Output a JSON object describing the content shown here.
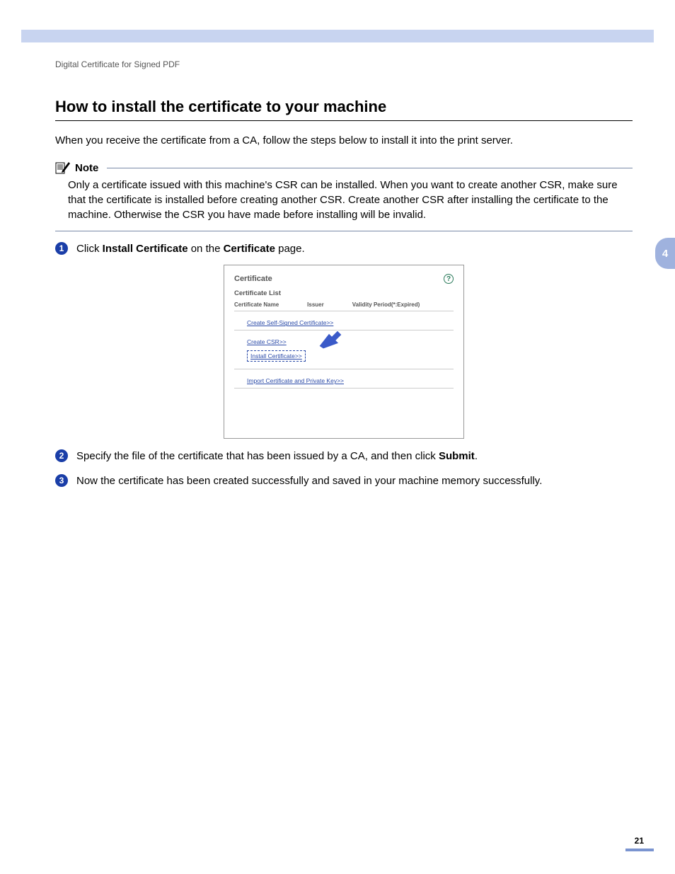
{
  "breadcrumb": "Digital Certificate for Signed PDF",
  "heading": "How to install the certificate to your machine",
  "intro": "When you receive the certificate from a CA, follow the steps below to install it into the print server.",
  "note": {
    "label": "Note",
    "body": "Only a certificate issued with this machine's CSR can be installed. When you want to create another CSR, make sure that the certificate is installed before creating another CSR. Create another CSR after installing the certificate to the machine. Otherwise the CSR you have made before installing will be invalid."
  },
  "steps": {
    "s1_pre": "Click ",
    "s1_b1": "Install Certificate",
    "s1_mid": " on the ",
    "s1_b2": "Certificate",
    "s1_post": " page.",
    "s2_pre": "Specify the file of the certificate that has been issued by a CA, and then click ",
    "s2_b1": "Submit",
    "s2_post": ".",
    "s3": "Now the certificate has been created successfully and saved in your machine memory successfully."
  },
  "screenshot": {
    "title": "Certificate",
    "subtitle": "Certificate List",
    "col1": "Certificate Name",
    "col2": "Issuer",
    "col3": "Validity Period(*:Expired)",
    "link1": "Create Self-Signed Certificate>>",
    "link2": "Create CSR>>",
    "link3": "Install Certificate>>",
    "link4": "Import Certificate and Private Key>>",
    "help": "?"
  },
  "chapter": "4",
  "page": "21"
}
